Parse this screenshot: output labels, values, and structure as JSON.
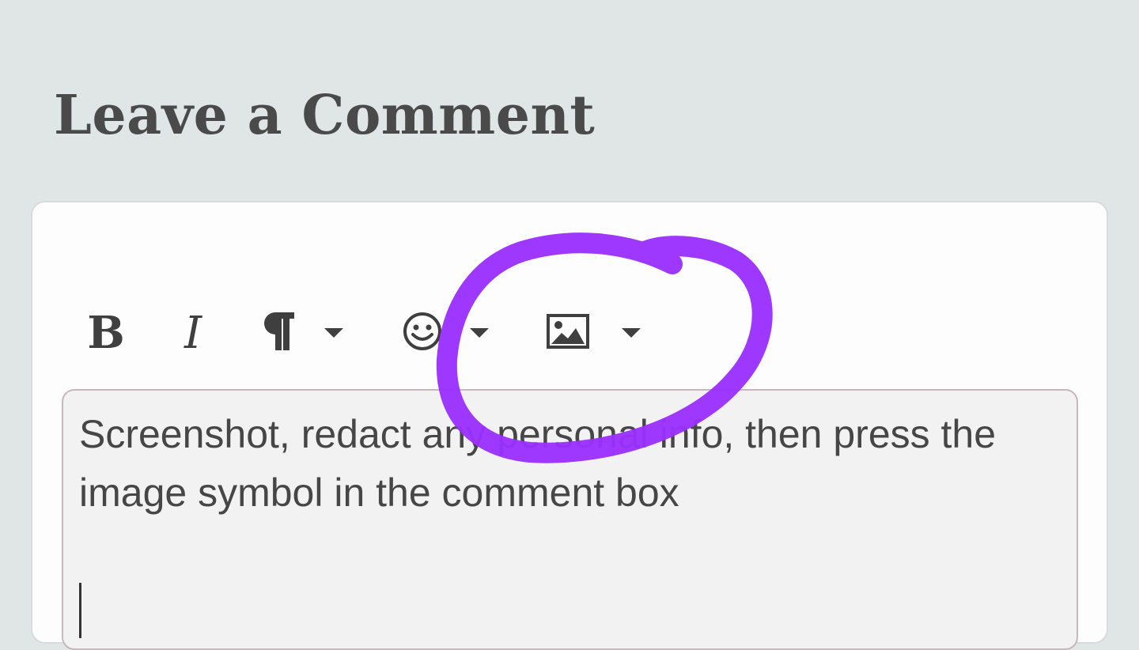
{
  "page": {
    "title": "Leave a Comment"
  },
  "toolbar": {
    "bold_label": "B",
    "italic_label": "I",
    "paragraph_icon": "paragraph-icon",
    "emoji_icon": "emoji-icon",
    "image_icon": "image-icon",
    "dropdown_icon": "chevron-down-icon"
  },
  "editor": {
    "value": "Screenshot, redact any personal info, then press the image symbol in the comment box"
  },
  "annotation": {
    "color": "#9b30ff",
    "shape": "hand-drawn-circle",
    "target": "image-button"
  }
}
